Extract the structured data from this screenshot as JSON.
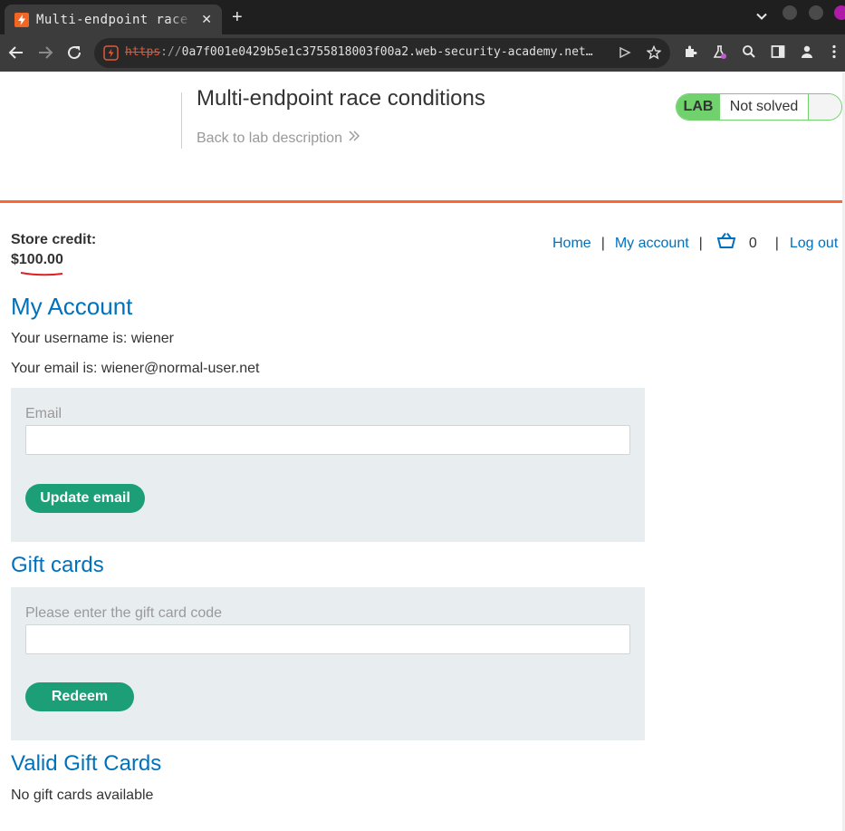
{
  "browser": {
    "tab_title": "Multi-endpoint race conditions",
    "tab_close": "✕",
    "new_tab": "+",
    "url_protocol": "https",
    "url_separator": "://",
    "url_host": "0a7f001e0429b5e1c3755818003f00a2.web-security-academy.net…"
  },
  "lab": {
    "title": "Multi-endpoint race conditions",
    "back_link": "Back to lab description",
    "status_label": "LAB",
    "status_text": "Not solved"
  },
  "store": {
    "credit_label": "Store credit:",
    "credit_currency": "$",
    "credit_amount": "100.00"
  },
  "nav": {
    "home": "Home",
    "separator": "|",
    "my_account": "My account",
    "cart_count": "0",
    "log_out": "Log out"
  },
  "account": {
    "heading": "My Account",
    "username_line": "Your username is: wiener",
    "email_line": "Your email is: wiener@normal-user.net",
    "email_label": "Email",
    "email_value": "",
    "update_button": "Update email"
  },
  "gift_cards": {
    "heading": "Gift cards",
    "code_label": "Please enter the gift card code",
    "code_value": "",
    "redeem_button": "Redeem"
  },
  "valid_gift_cards": {
    "heading": "Valid Gift Cards",
    "empty_text": "No gift cards available"
  },
  "colors": {
    "accent_link": "#0071bc",
    "button_green": "#1c9e77",
    "header_orange": "#ff6633",
    "lab_green": "#70d16d"
  }
}
